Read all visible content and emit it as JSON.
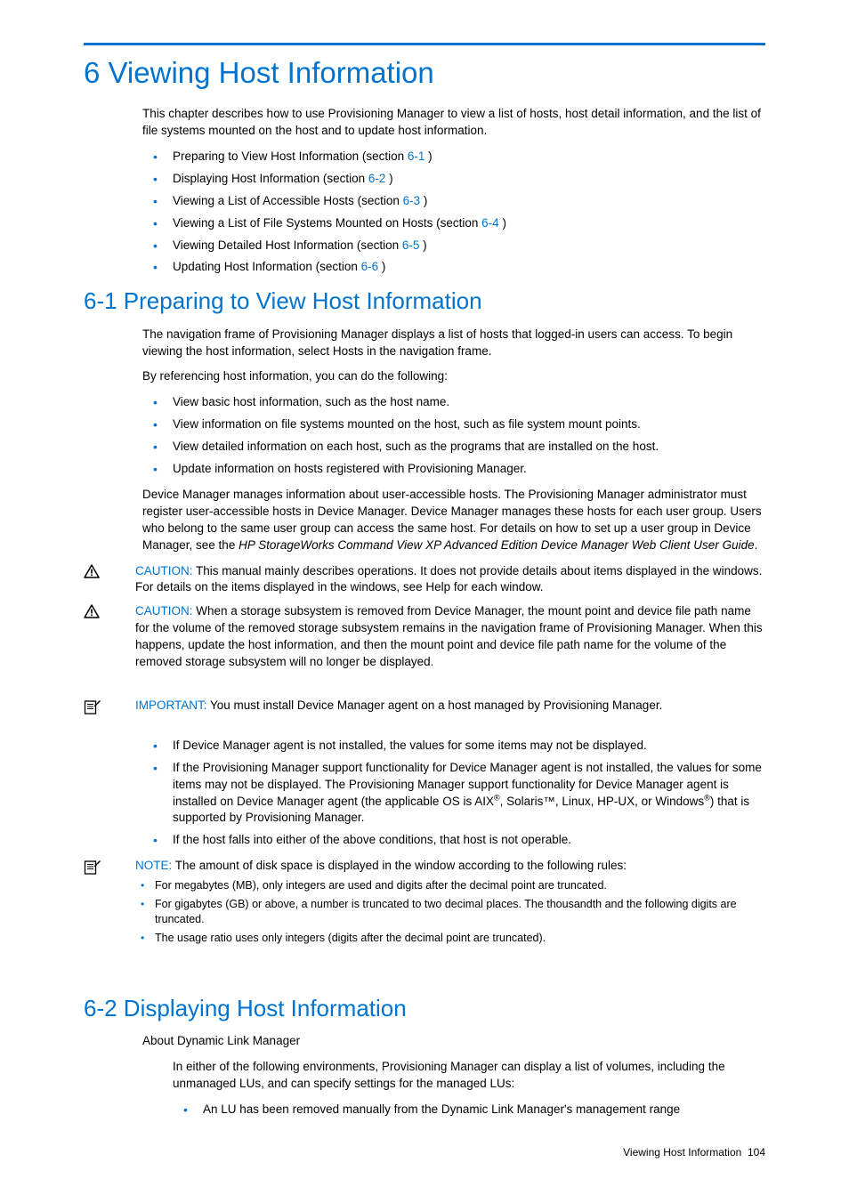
{
  "h1": "6 Viewing Host Information",
  "intro": "This chapter describes how to use Provisioning Manager to view a list of hosts, host detail information, and the list of file systems mounted on the host and to update host information.",
  "toc": [
    {
      "text": "Preparing to View Host Information (section ",
      "ref": "6-1",
      "tail": " )"
    },
    {
      "text": "Displaying Host Information (section ",
      "ref": "6-2",
      "tail": " )"
    },
    {
      "text": "Viewing a List of Accessible Hosts (section ",
      "ref": "6-3",
      "tail": " )"
    },
    {
      "text": "Viewing a List of File Systems Mounted on Hosts (section ",
      "ref": "6-4",
      "tail": " )"
    },
    {
      "text": "Viewing Detailed Host Information (section ",
      "ref": "6-5",
      "tail": " )"
    },
    {
      "text": "Updating Host Information (section ",
      "ref": "6-6",
      "tail": " )"
    }
  ],
  "s61": {
    "title": "6-1 Preparing to View Host Information",
    "p1": "The navigation frame of Provisioning Manager displays a list of hosts that logged-in users can access. To begin viewing the host information, select Hosts in the navigation frame.",
    "p2": "By referencing host information, you can do the following:",
    "bullets": [
      "View basic host information, such as the host name.",
      "View information on file systems mounted on the host, such as file system mount points.",
      "View detailed information on each host, such as the programs that are installed on the host.",
      "Update information on hosts registered with Provisioning Manager."
    ],
    "p3a": "Device Manager manages information about user-accessible hosts. The Provisioning Manager administrator must register user-accessible hosts in Device Manager. Device Manager manages these hosts for each user group. Users who belong to the same user group can access the same host. For details on how to set up a user group in Device Manager, see the ",
    "p3b_italic": "HP StorageWorks Command View XP Advanced Edition Device Manager Web Client User Guide",
    "p3c": ".",
    "caution1_label": "CAUTION:",
    "caution1": "  This manual mainly describes operations. It does not provide details about items displayed in the windows. For details on the items displayed in the windows, see Help for each window.",
    "caution2_label": "CAUTION:",
    "caution2": "  When a storage subsystem is removed from Device Manager, the mount point and device file path name for the volume of the removed storage subsystem remains in the navigation frame of Provisioning Manager. When this happens, update the host information, and then the mount point and device file path name for the volume of the removed storage subsystem will no longer be displayed.",
    "important_label": "IMPORTANT:",
    "important": "  You must install Device Manager agent on a host managed by Provisioning Manager.",
    "bullets2": {
      "b1": "If Device Manager agent is not installed, the values for some items may not be displayed.",
      "b2a": "If the Provisioning Manager support functionality for Device Manager agent is not installed, the values for some items may not be displayed. The Provisioning Manager support functionality for Device Manager agent is installed on Device Manager agent (the applicable OS is AIX",
      "b2sup1": "®",
      "b2b": ", Solaris™, Linux, HP-UX, or Windows",
      "b2sup2": "®",
      "b2c": ") that is supported by Provisioning Manager.",
      "b3": "If the host falls into either of the above conditions, that host is not operable."
    },
    "note_label": "NOTE:",
    "note_lead": "  The amount of disk space is displayed in the window according to the following rules:",
    "note_bullets": [
      "For megabytes (MB), only integers are used and digits after the decimal point are truncated.",
      "For gigabytes (GB) or above, a number is truncated to two decimal places. The thousandth and the following digits are truncated.",
      "The usage ratio uses only integers (digits after the decimal point are truncated)."
    ]
  },
  "s62": {
    "title": "6-2 Displaying Host Information",
    "sub": "About Dynamic Link Manager",
    "p1": "In either of the following environments, Provisioning Manager can display a list of volumes, including the unmanaged LUs, and can specify settings for the managed LUs:",
    "bullets": [
      "An LU has been removed manually from the Dynamic Link Manager's management range"
    ]
  },
  "footer_text": "Viewing Host Information",
  "footer_page": "104"
}
